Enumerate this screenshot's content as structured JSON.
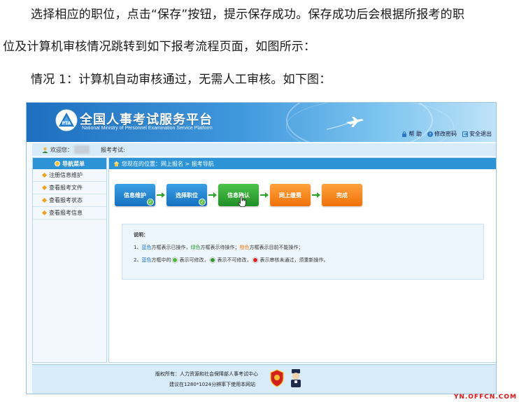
{
  "paragraphs": {
    "p1": "选择相应的职位，点击“保存”按钮，提示保存成功。保存成功后会根据所报考的职",
    "p2": "位及计算机审核情况跳转到如下报考流程页面，如图所示：",
    "p3": "情况 1：计算机自动审核通过，无需人工审核。如下图："
  },
  "screenshot": {
    "site_title": "全国人事考试服务平台",
    "site_subtitle": "National Ministry of Personnel Examination Service Platform",
    "top_links": [
      "帮 助",
      "修改密码",
      "安全退出"
    ],
    "welcome": "欢迎您：",
    "exam_label": "报考考试:",
    "sidebar": {
      "header": "导航菜单",
      "items": [
        "注册信息维护",
        "查看报考文件",
        "查看报考状态",
        "查看报考信息"
      ]
    },
    "breadcrumb": "您现在的位置：网上报名 > 报考导航",
    "steps": [
      "信息维护",
      "选择职位",
      "信息确认",
      "网上缴费",
      "完成"
    ],
    "note": {
      "title": "说明：",
      "line1": {
        "prefix": "1、",
        "blue": "蓝色",
        "t1": "方框表示已操作，",
        "green": "绿色",
        "t2": "方框表示待操作；",
        "orange": "橙色",
        "t3": "方框表示目前不能操作；"
      },
      "line2": {
        "prefix": "2、",
        "blue": "蓝色",
        "t1": "方框中的",
        "t2": "表示可修改，",
        "t3": "表示不可修改，",
        "t4": "表示审核未通过，须重新操作。"
      }
    },
    "footer": {
      "line1": "版权所有：人力资源和社会保障部人事考试中心",
      "line2": "建议在1280*1024分辨率下使用本网站"
    },
    "colors": {
      "blue": "#1670c0",
      "green": "#1f8f27",
      "orange": "#f07209",
      "header_blue": "#2b93d6"
    }
  },
  "watermark": "YN.OFFCN.COM"
}
